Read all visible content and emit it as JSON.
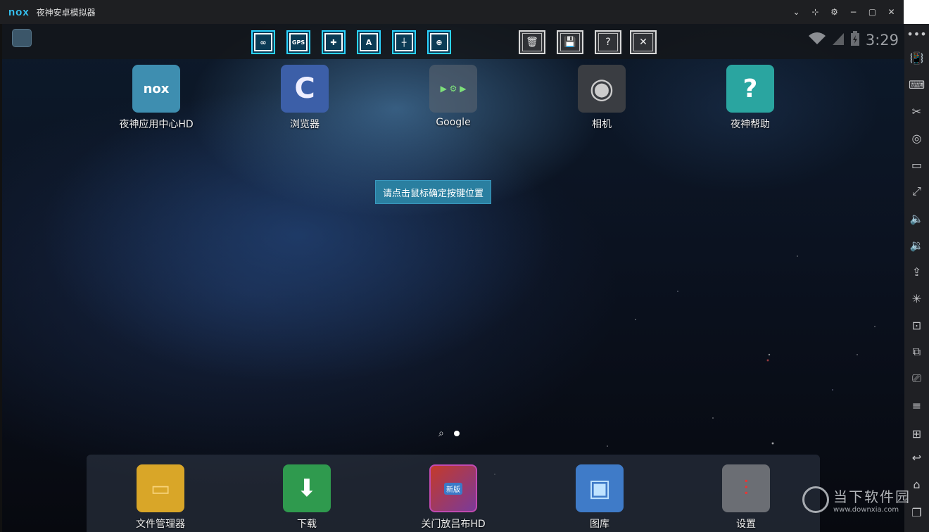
{
  "window": {
    "logo_text": "nox",
    "title": "夜神安卓模拟器",
    "controls": [
      "chevron-down-icon",
      "pin-icon",
      "gear-icon",
      "minimize-icon",
      "maximize-icon",
      "close-icon"
    ]
  },
  "statusbar": {
    "key_tools": [
      {
        "name": "gesture-tool",
        "glyph": "∞"
      },
      {
        "name": "gps-tool",
        "glyph": "GPS"
      },
      {
        "name": "dpad-tool",
        "glyph": "✚"
      },
      {
        "name": "key-a-tool",
        "glyph": "A"
      },
      {
        "name": "crosshair-tool",
        "glyph": "┼"
      },
      {
        "name": "aim-tool",
        "glyph": "⊕"
      }
    ],
    "actions": [
      {
        "name": "delete",
        "glyph": "🗑"
      },
      {
        "name": "save",
        "glyph": "💾"
      },
      {
        "name": "help",
        "glyph": "?"
      },
      {
        "name": "close",
        "glyph": "✕"
      }
    ],
    "time": "3:29"
  },
  "apps": [
    {
      "label": "夜神应用中心HD",
      "icon": "nox-app-center-icon",
      "color": "#3e8eb0",
      "glyph": "nox"
    },
    {
      "label": "浏览器",
      "icon": "browser-icon",
      "color": "#3c5fa8",
      "glyph": "C"
    },
    {
      "label": "Google",
      "icon": "google-folder-icon",
      "color": "#5a6470",
      "glyph": "▶ ⚙ ▶"
    },
    {
      "label": "相机",
      "icon": "camera-icon",
      "color": "#3a3d42",
      "glyph": "◉"
    },
    {
      "label": "夜神帮助",
      "icon": "nox-help-icon",
      "color": "#2aa5a0",
      "glyph": "?"
    }
  ],
  "hint": "请点击鼠标确定按键位置",
  "dock": [
    {
      "label": "文件管理器",
      "icon": "file-manager-icon",
      "color": "#d9a628",
      "glyph": "▭"
    },
    {
      "label": "下载",
      "icon": "download-icon",
      "color": "#2f9a4e",
      "glyph": "⬇"
    },
    {
      "label": "关门放吕布HD",
      "icon": "game-icon",
      "color": "#b04a2a",
      "glyph": "新版"
    },
    {
      "label": "图库",
      "icon": "gallery-icon",
      "color": "#3f7bc8",
      "glyph": "▣"
    },
    {
      "label": "设置",
      "icon": "settings-icon",
      "color": "#6b6e74",
      "glyph": "⫶"
    }
  ],
  "sidebar": [
    {
      "name": "more-icon",
      "glyph": "•••"
    },
    {
      "name": "shake-icon",
      "glyph": "📳"
    },
    {
      "name": "keyboard-icon",
      "glyph": "⌨"
    },
    {
      "name": "scissors-icon",
      "glyph": "✂"
    },
    {
      "name": "location-icon",
      "glyph": "◎"
    },
    {
      "name": "screen-icon",
      "glyph": "▭"
    },
    {
      "name": "fullscreen-icon",
      "glyph": "⤢"
    },
    {
      "name": "volume-up-icon",
      "glyph": "🔈"
    },
    {
      "name": "volume-down-icon",
      "glyph": "🔉"
    },
    {
      "name": "apk-install-icon",
      "glyph": "⇪"
    },
    {
      "name": "loading-icon",
      "glyph": "✳"
    },
    {
      "name": "mouse-keymap-icon",
      "glyph": "⊡"
    },
    {
      "name": "multi-instance-icon",
      "glyph": "⧉"
    },
    {
      "name": "recorder-icon",
      "glyph": "⎚"
    },
    {
      "name": "menu-icon",
      "glyph": "≡"
    },
    {
      "name": "add-icon",
      "glyph": "⊞"
    },
    {
      "name": "back-icon",
      "glyph": "↩"
    },
    {
      "name": "home-icon",
      "glyph": "⌂"
    },
    {
      "name": "recent-icon",
      "glyph": "❐"
    }
  ],
  "watermark": {
    "title": "当下软件园",
    "url": "www.downxia.com"
  }
}
